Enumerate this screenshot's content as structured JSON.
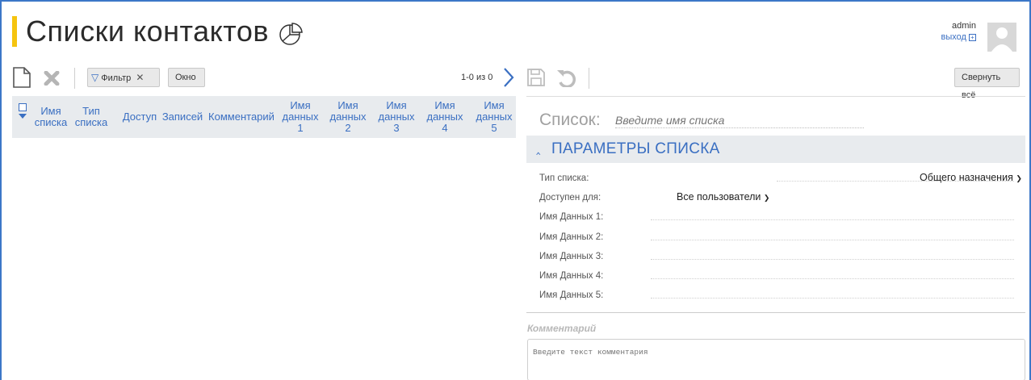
{
  "header": {
    "title": "Списки контактов",
    "user_name": "admin",
    "logout_label": "выход"
  },
  "toolbar": {
    "filter_label": "Фильтр",
    "window_label": "Окно",
    "pager_text": "1-0 из 0",
    "collapse_label": "Свернуть всё"
  },
  "grid": {
    "columns": [
      "Имя списка",
      "Тип списка",
      "Доступ",
      "Записей",
      "Комментарий",
      "Имя данных 1",
      "Имя данных 2",
      "Имя данных 3",
      "Имя данных 4",
      "Имя данных 5"
    ]
  },
  "form": {
    "list_label": "Список:",
    "list_placeholder": "Введите имя списка",
    "section_title": "ПАРАМЕТРЫ СПИСКА",
    "fields": [
      {
        "label": "Тип списка:",
        "value": "Общего назначения"
      },
      {
        "label": "Доступен для:",
        "value": "Все пользователи"
      },
      {
        "label": "Имя Данных 1:",
        "value": ""
      },
      {
        "label": "Имя Данных 2:",
        "value": ""
      },
      {
        "label": "Имя Данных 3:",
        "value": ""
      },
      {
        "label": "Имя Данных 4:",
        "value": ""
      },
      {
        "label": "Имя Данных 5:",
        "value": ""
      }
    ],
    "comment_label": "Комментарий",
    "comment_placeholder": "Введите текст комментария"
  },
  "colors": {
    "accent": "#3a6fc2",
    "title_marker": "#f5c40f",
    "header_bg": "#e8ebee"
  }
}
